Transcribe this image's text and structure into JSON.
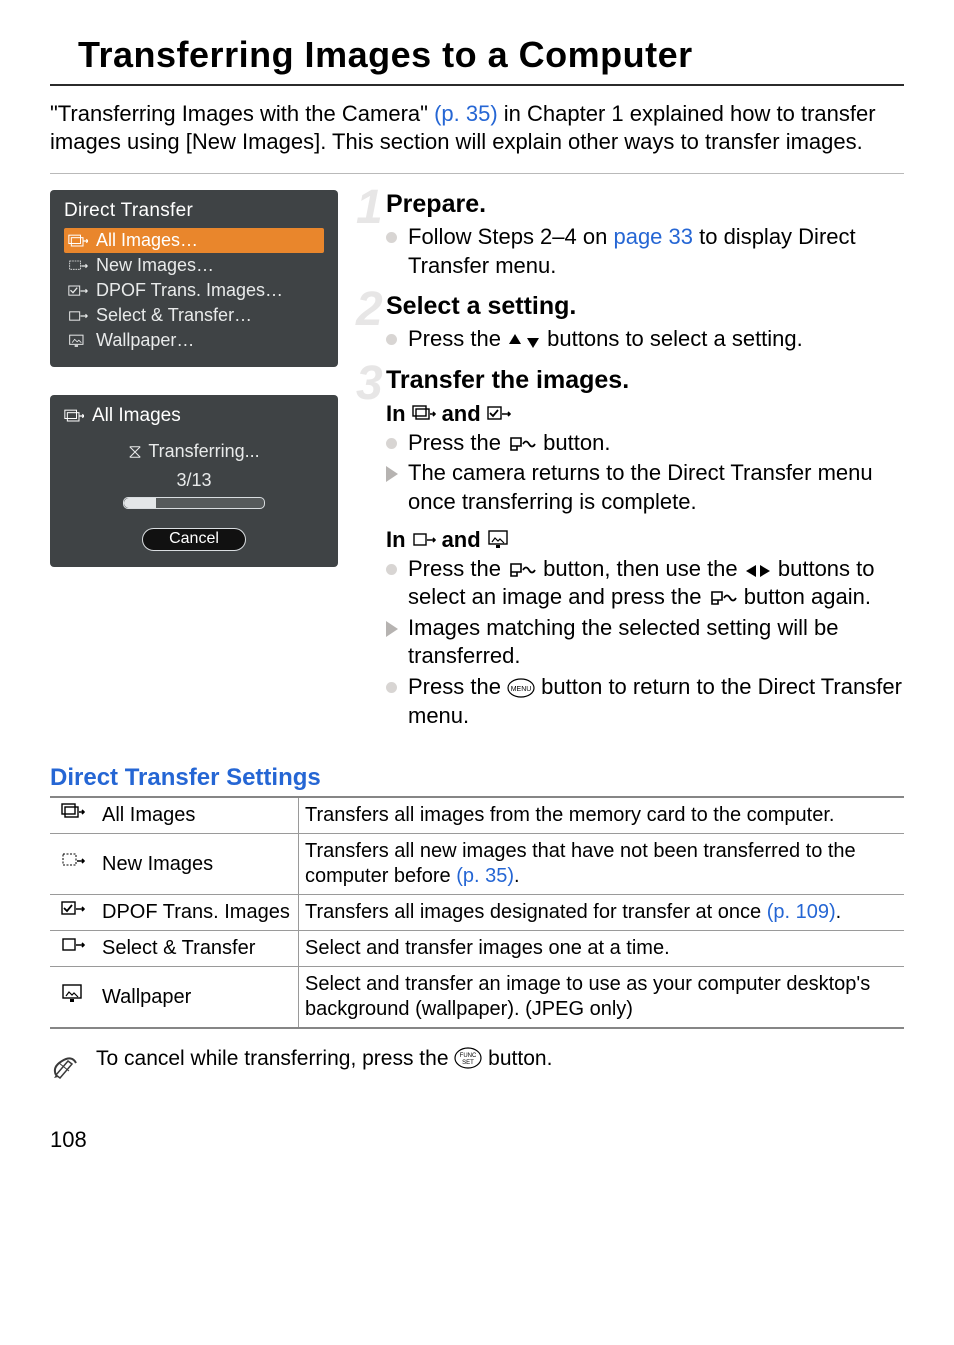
{
  "page": {
    "title": "Transferring Images to a Computer",
    "number": "108"
  },
  "intro": {
    "pre": "\"Transferring Images with the Camera\" ",
    "link": "(p. 35)",
    "post": " in Chapter 1 explained how to transfer images using [New Images]. This section will explain other ways to transfer images."
  },
  "lcd_menu": {
    "title": "Direct Transfer",
    "items": [
      {
        "label": "All Images…",
        "selected": true,
        "icon": "stack-arrow"
      },
      {
        "label": "New Images…",
        "selected": false,
        "icon": "dots-arrow"
      },
      {
        "label": "DPOF Trans. Images…",
        "selected": false,
        "icon": "check-arrow"
      },
      {
        "label": "Select & Transfer…",
        "selected": false,
        "icon": "single-arrow"
      },
      {
        "label": "Wallpaper…",
        "selected": false,
        "icon": "monitor"
      }
    ]
  },
  "lcd_progress": {
    "header": "All Images",
    "status": "Transferring...",
    "counter": "3/13",
    "cancel": "Cancel"
  },
  "steps": [
    {
      "num": "1",
      "head": "Prepare.",
      "lines": [
        {
          "type": "dot",
          "pre": "Follow Steps 2–4 on ",
          "link": "page 33",
          "post": " to display Direct Transfer menu."
        }
      ]
    },
    {
      "num": "2",
      "head": "Select a setting.",
      "lines": [
        {
          "type": "dot",
          "pre": "Press the ",
          "icons": "updown",
          "post": " buttons to select a setting."
        }
      ]
    },
    {
      "num": "3",
      "head": "Transfer the images.",
      "sections": [
        {
          "subhead_pre": "In ",
          "subhead_icons": "stack-check",
          "subhead_mid": " and ",
          "lines": [
            {
              "type": "dot",
              "pre": "Press the ",
              "icons": "dptilde",
              "post": " button."
            },
            {
              "type": "tri",
              "pre": "The camera returns to the Direct Transfer menu once transferring is complete."
            }
          ]
        },
        {
          "subhead_pre": "In ",
          "subhead_icons": "single-monitor",
          "subhead_mid": " and ",
          "lines": [
            {
              "type": "dot",
              "pre": "Press the ",
              "icons": "dptilde",
              "mid1": " button, then use the ",
              "icons2": "leftright",
              "mid2": " buttons to select an image and press the ",
              "icons3": "dptilde",
              "post": " button again."
            },
            {
              "type": "tri",
              "pre": "Images matching the selected setting will be transferred."
            },
            {
              "type": "dot",
              "pre": "Press the ",
              "icons": "menu",
              "post": " button to return to the Direct Transfer menu."
            }
          ]
        }
      ]
    }
  ],
  "settings_section": {
    "heading": "Direct Transfer Settings",
    "rows": [
      {
        "icon": "stack-arrow",
        "name": "All Images",
        "desc": "Transfers all images from the memory card to the computer."
      },
      {
        "icon": "dots-arrow",
        "name": "New Images",
        "desc_pre": "Transfers all new images that have not been transferred to the computer before ",
        "link": "(p. 35)",
        "desc_post": "."
      },
      {
        "icon": "check-arrow",
        "name": "DPOF Trans. Images",
        "desc_pre": "Transfers all images designated for transfer at once ",
        "link": "(p. 109)",
        "desc_post": "."
      },
      {
        "icon": "single-arrow",
        "name": "Select & Transfer",
        "desc": "Select and transfer images one at a time."
      },
      {
        "icon": "monitor",
        "name": "Wallpaper",
        "desc": "Select and transfer an image to use as your computer desktop's background (wallpaper). (JPEG only)"
      }
    ]
  },
  "note": {
    "pre": "To cancel while transferring, press the ",
    "post": " button."
  }
}
